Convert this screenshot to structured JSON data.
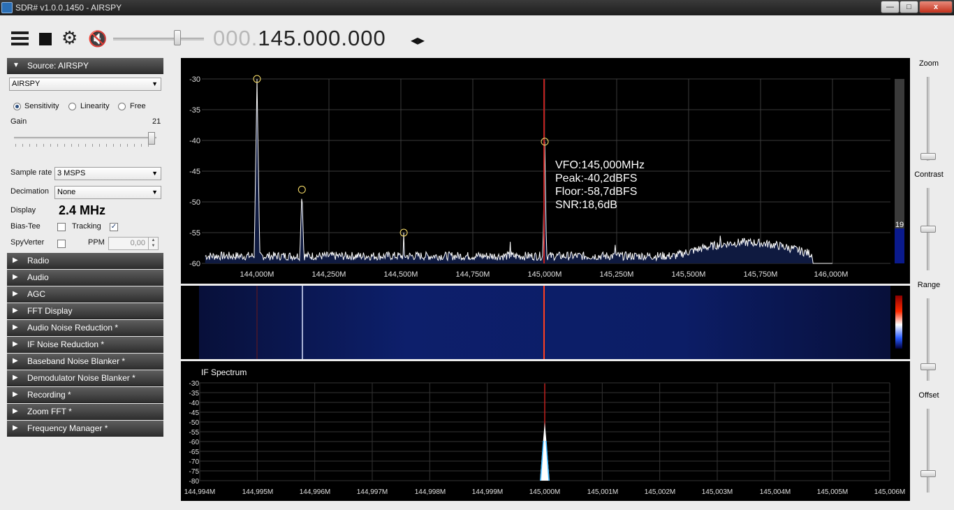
{
  "window": {
    "title": "SDR# v1.0.0.1450 - AIRSPY",
    "min": "—",
    "max": "□",
    "close": "x"
  },
  "toolbar": {
    "menu_icon": "hamburger-icon",
    "stop_icon": "stop-icon",
    "gear_icon": "⚙",
    "mute_icon": "🔇",
    "freq_prefix": "000.",
    "freq_main": "145.000.000",
    "freq_arrows": "◂▸",
    "volume_level": 0.68
  },
  "source": {
    "header": "Source: AIRSPY",
    "device": "AIRSPY",
    "modes": [
      "Sensitivity",
      "Linearity",
      "Free"
    ],
    "selected_mode": "Sensitivity",
    "gain_label": "Gain",
    "gain_value": "21",
    "sample_rate_label": "Sample rate",
    "sample_rate": "3 MSPS",
    "decimation_label": "Decimation",
    "decimation": "None",
    "display_label": "Display",
    "display_value": "2.4 MHz",
    "bias_tee_label": "Bias-Tee",
    "bias_tee": false,
    "tracking_label": "Tracking",
    "tracking": true,
    "spyverter_label": "SpyVerter",
    "spyverter": false,
    "ppm_label": "PPM",
    "ppm_value": "0,00"
  },
  "sections": [
    "Radio",
    "Audio",
    "AGC",
    "FFT Display",
    "Audio Noise Reduction *",
    "IF Noise Reduction *",
    "Baseband Noise Blanker *",
    "Demodulator Noise Blanker *",
    "Recording *",
    "Zoom FFT *",
    "Frequency Manager *"
  ],
  "right_controls": {
    "zoom_label": "Zoom",
    "zoom_level": 0.08,
    "contrast_label": "Contrast",
    "contrast_level": 0.5,
    "range_label": "Range",
    "range_level": 0.12,
    "offset_label": "Offset",
    "offset_level": 0.1
  },
  "spectrum": {
    "y_ticks": [
      "-30",
      "-35",
      "-40",
      "-45",
      "-50",
      "-55",
      "-60"
    ],
    "x_ticks": [
      "144,000M",
      "144,250M",
      "144,500M",
      "144,750M",
      "145,000M",
      "145,250M",
      "145,500M",
      "145,750M",
      "146,000M"
    ],
    "vfo": "VFO:145,000MHz",
    "peak": "Peak:-40,2dBFS",
    "floor": "Floor:-58,7dBFS",
    "snr": "SNR:18,6dB",
    "side_bar_value": "19",
    "vfo_freq_mhz": 145.0
  },
  "ifspectrum": {
    "title": "IF Spectrum",
    "y_ticks": [
      "-30",
      "-35",
      "-40",
      "-45",
      "-50",
      "-55",
      "-60",
      "-65",
      "-70",
      "-75",
      "-80"
    ],
    "x_ticks": [
      "144,994M",
      "144,995M",
      "144,996M",
      "144,997M",
      "144,998M",
      "144,999M",
      "145,000M",
      "145,001M",
      "145,002M",
      "145,003M",
      "145,004M",
      "145,005M",
      "145,006M"
    ]
  },
  "colors": {
    "vfo_line": "#c0201f",
    "bg": "#000000",
    "grid": "#3a3a3a",
    "waterfall": "#0b1a5c",
    "trace_fill": "#0f1a40"
  }
}
